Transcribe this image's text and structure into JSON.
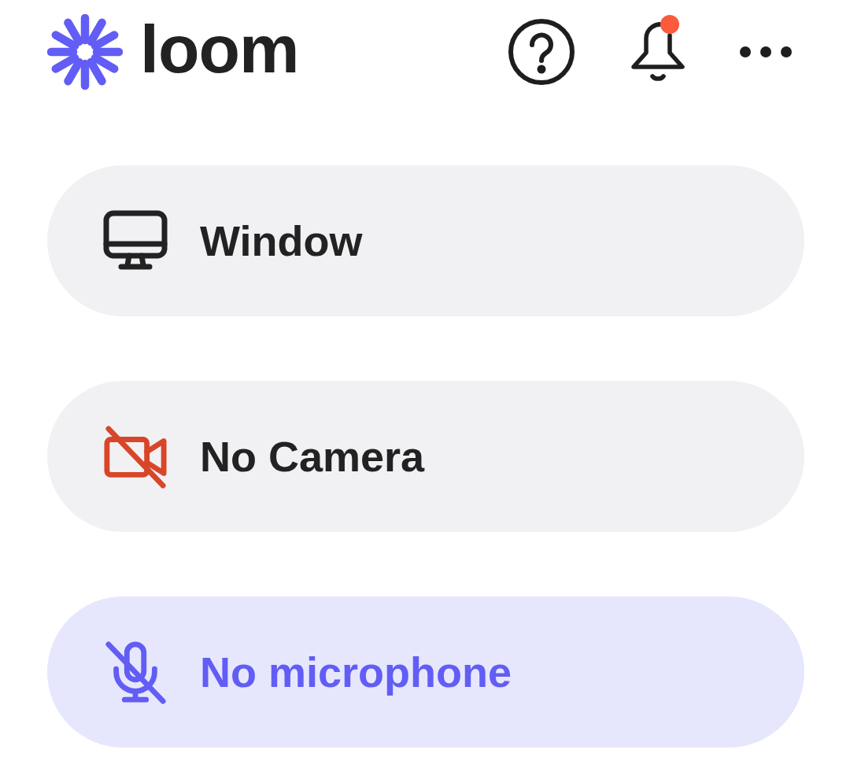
{
  "header": {
    "logo": {
      "text": "loom"
    },
    "notifications": {
      "unread": true
    }
  },
  "sources": [
    {
      "kind": "screen",
      "label": "Window",
      "off": false,
      "selected": false
    },
    {
      "kind": "camera",
      "label": "No Camera",
      "off": true,
      "selected": false
    },
    {
      "kind": "microphone",
      "label": "No microphone",
      "off": true,
      "selected": true
    }
  ]
}
